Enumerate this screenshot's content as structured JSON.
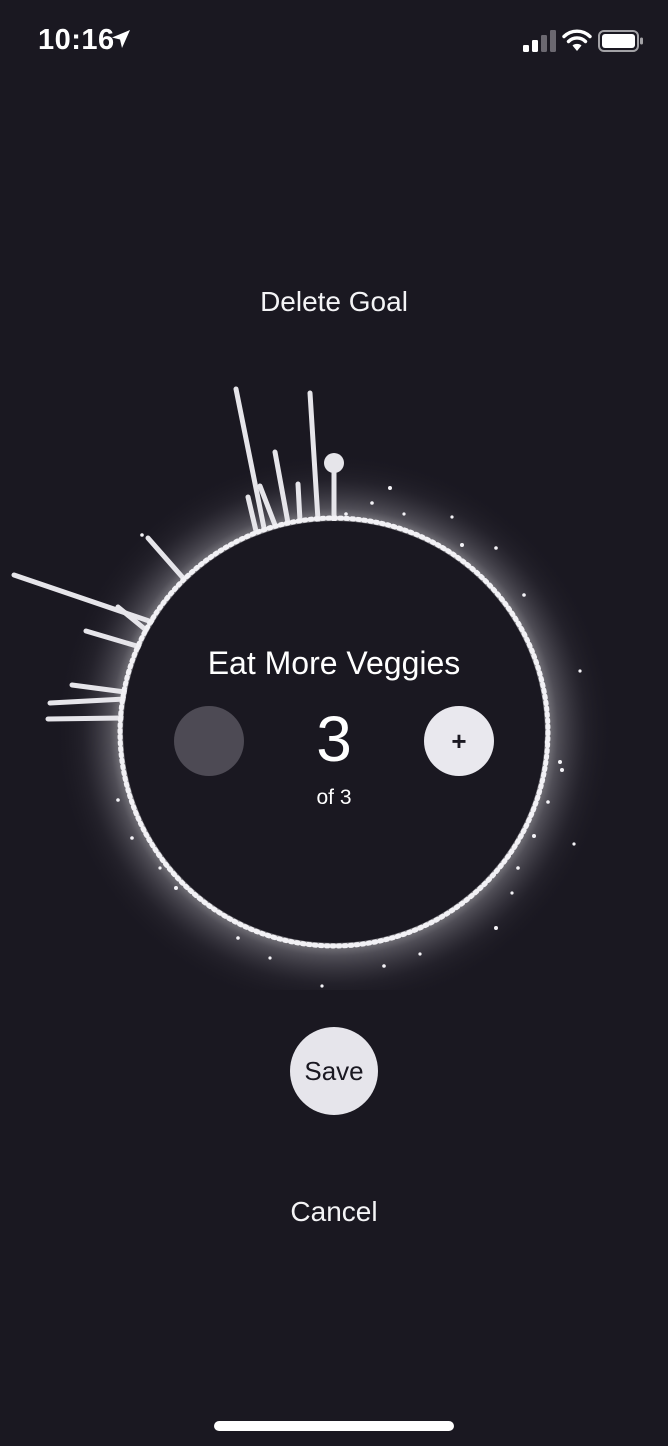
{
  "status_bar": {
    "time": "10:16",
    "icons": [
      "location-arrow-icon",
      "cellular-signal-icon",
      "wifi-icon",
      "battery-icon"
    ]
  },
  "actions": {
    "delete_label": "Delete Goal",
    "save_label": "Save",
    "cancel_label": "Cancel"
  },
  "goal": {
    "title": "Eat More Veggies",
    "count": "3",
    "total_label": "of 3",
    "increment_label": "+",
    "decrement_label": ""
  },
  "colors": {
    "background": "#1a1821",
    "accent": "#e6e5eb",
    "disabled_button": "#4d4a54",
    "text": "#ffffff"
  }
}
